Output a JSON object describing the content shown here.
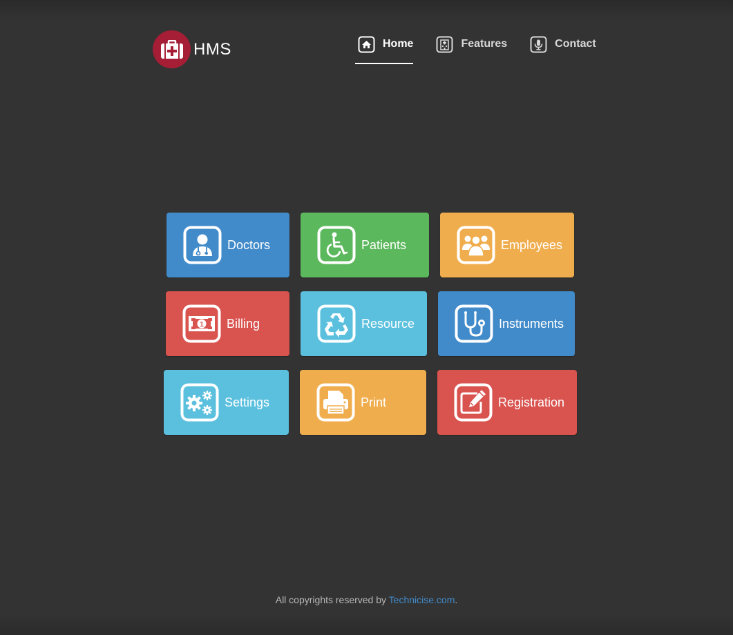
{
  "brand": {
    "name": "HMS",
    "logo_color": "#a51e36",
    "logo_icon": "medkit-icon"
  },
  "nav": {
    "items": [
      {
        "label": "Home",
        "icon": "home-icon",
        "active": true
      },
      {
        "label": "Features",
        "icon": "hospital-icon",
        "active": false
      },
      {
        "label": "Contact",
        "icon": "microphone-icon",
        "active": false
      }
    ]
  },
  "tiles": [
    {
      "label": "Doctors",
      "icon": "user-md-icon",
      "color": "#428bca"
    },
    {
      "label": "Patients",
      "icon": "wheelchair-icon",
      "color": "#5cb85c"
    },
    {
      "label": "Employees",
      "icon": "users-icon",
      "color": "#f0ad4e"
    },
    {
      "label": "Billing",
      "icon": "money-icon",
      "color": "#d9534f"
    },
    {
      "label": "Resource",
      "icon": "recycle-icon",
      "color": "#5bc0de"
    },
    {
      "label": "Instruments",
      "icon": "stethoscope-icon",
      "color": "#428bca"
    },
    {
      "label": "Settings",
      "icon": "cogs-icon",
      "color": "#5bc0de"
    },
    {
      "label": "Print",
      "icon": "print-icon",
      "color": "#f0ad4e"
    },
    {
      "label": "Registration",
      "icon": "edit-icon",
      "color": "#d9534f"
    }
  ],
  "footer": {
    "text": "All copyrights reserved by ",
    "link_text": "Technicise.com",
    "suffix": ".",
    "link_color": "#428bca"
  }
}
